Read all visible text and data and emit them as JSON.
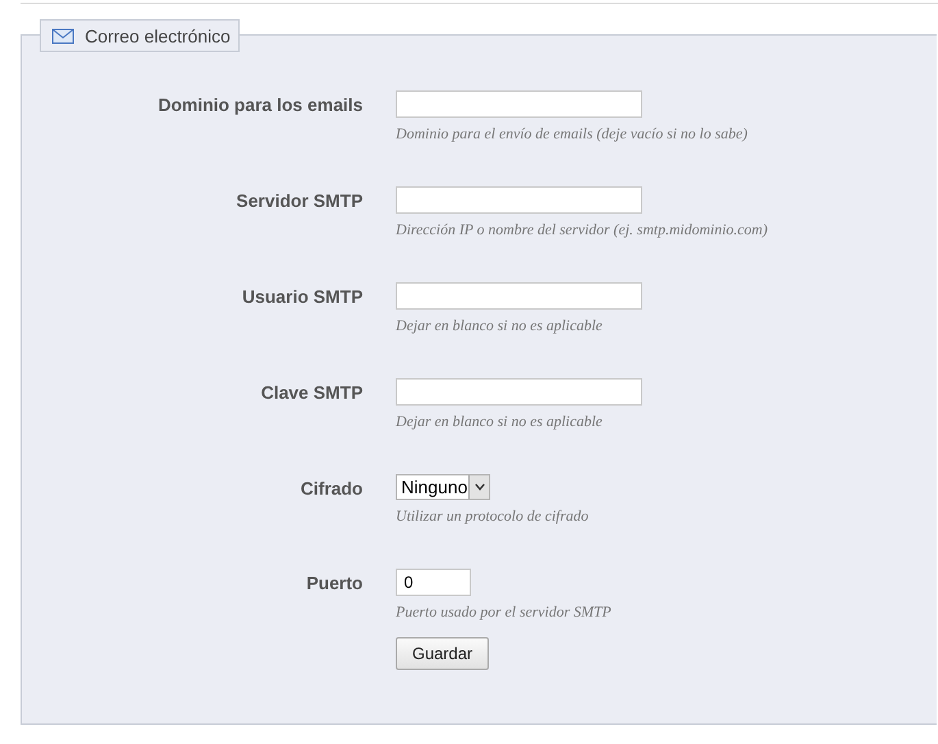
{
  "section": {
    "title": "Correo electrónico"
  },
  "fields": [
    {
      "kind": "text",
      "label": "Dominio para los emails",
      "hint": "Dominio para el envío de emails (deje vacío si no lo sabe)"
    },
    {
      "kind": "text",
      "label": "Servidor SMTP",
      "hint": "Dirección IP o nombre del servidor (ej. smtp.midominio.com)"
    },
    {
      "kind": "text",
      "label": "Usuario SMTP",
      "hint": "Dejar en blanco si no es aplicable"
    },
    {
      "kind": "text",
      "label": "Clave SMTP",
      "hint": "Dejar en blanco si no es aplicable"
    },
    {
      "kind": "select",
      "label": "Cifrado",
      "value": "Ninguno",
      "hint": "Utilizar un protocolo de cifrado"
    },
    {
      "kind": "number",
      "label": "Puerto",
      "value": "0",
      "hint": "Puerto usado por el servidor SMTP"
    }
  ],
  "button": "Guardar"
}
